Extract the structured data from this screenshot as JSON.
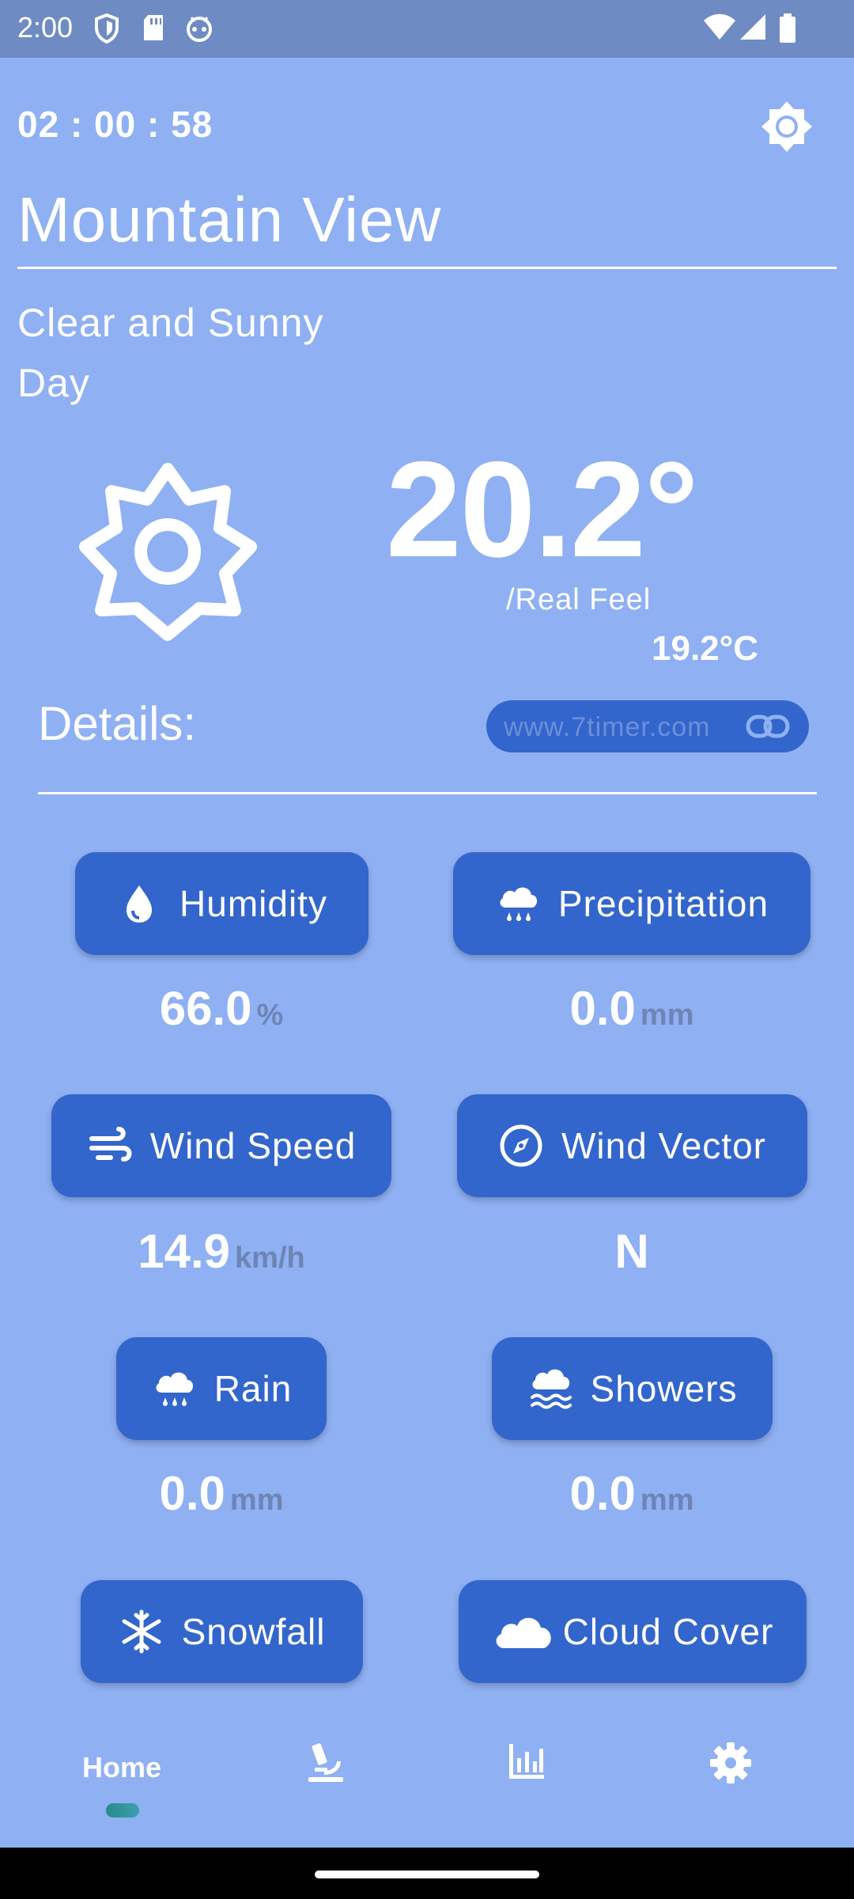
{
  "status_bar": {
    "time": "2:00"
  },
  "header": {
    "clock": "02 : 00 : 58",
    "city": "Mountain View"
  },
  "current": {
    "condition": "Clear and Sunny Day",
    "temperature": "20.2°",
    "real_feel_label": "/Real Feel",
    "real_feel_value": "19.2°C"
  },
  "details": {
    "title": "Details:",
    "source_link": "www.7timer.com"
  },
  "metrics": [
    {
      "label": "Humidity",
      "value": "66.0",
      "unit": "%",
      "icon": "water-drop-icon"
    },
    {
      "label": "Precipitation",
      "value": "0.0",
      "unit": "mm",
      "icon": "rain-cloud-icon"
    },
    {
      "label": "Wind Speed",
      "value": "14.9",
      "unit": "km/h",
      "icon": "wind-icon"
    },
    {
      "label": "Wind Vector",
      "value": "N",
      "unit": "",
      "icon": "compass-icon"
    },
    {
      "label": "Rain",
      "value": "0.0",
      "unit": "mm",
      "icon": "rain-cloud-icon"
    },
    {
      "label": "Showers",
      "value": "0.0",
      "unit": "mm",
      "icon": "showers-icon"
    },
    {
      "label": "Snowfall",
      "value": "",
      "unit": "",
      "icon": "snowflake-icon"
    },
    {
      "label": "Cloud Cover",
      "value": "",
      "unit": "",
      "icon": "cloud-icon"
    }
  ],
  "nav": {
    "home_label": "Home"
  },
  "colors": {
    "background": "#8fb0f3",
    "accent": "#3366cc",
    "status_bar": "#6f8bc4"
  }
}
